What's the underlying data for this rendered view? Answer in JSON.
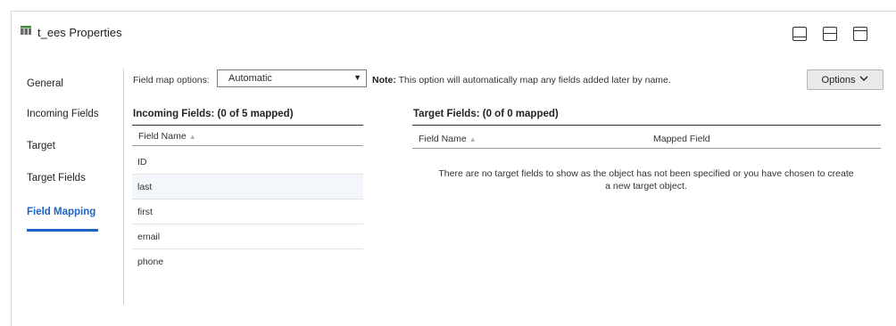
{
  "header": {
    "title": "t_ees Properties",
    "icon": "target-table-icon"
  },
  "layout_buttons": [
    "layout-bottom-icon",
    "layout-split-icon",
    "layout-top-icon"
  ],
  "nav": {
    "items": [
      {
        "label": "General",
        "active": false
      },
      {
        "label": "Incoming Fields",
        "active": false
      },
      {
        "label": "Target",
        "active": false
      },
      {
        "label": "Target Fields",
        "active": false
      },
      {
        "label": "Field Mapping",
        "active": true
      }
    ]
  },
  "field_map": {
    "label": "Field map options:",
    "selected": "Automatic",
    "note_prefix": "Note:",
    "note_text": " This option will automatically map any fields added later by name.",
    "options_label": "Options"
  },
  "incoming": {
    "title": "Incoming Fields: (0 of 5 mapped)",
    "column": "Field Name",
    "rows": [
      "ID",
      "last",
      "first",
      "email",
      "phone"
    ]
  },
  "target": {
    "title": "Target Fields: (0 of 0 mapped)",
    "column_name": "Field Name",
    "column_mapped": "Mapped Field",
    "empty_message_line1": "There are no target fields to show as the object has not been specified or you have chosen to create",
    "empty_message_line2": "a new target object."
  },
  "colors": {
    "accent": "#1b63c6",
    "highlight_row": "#f3f6fa"
  }
}
